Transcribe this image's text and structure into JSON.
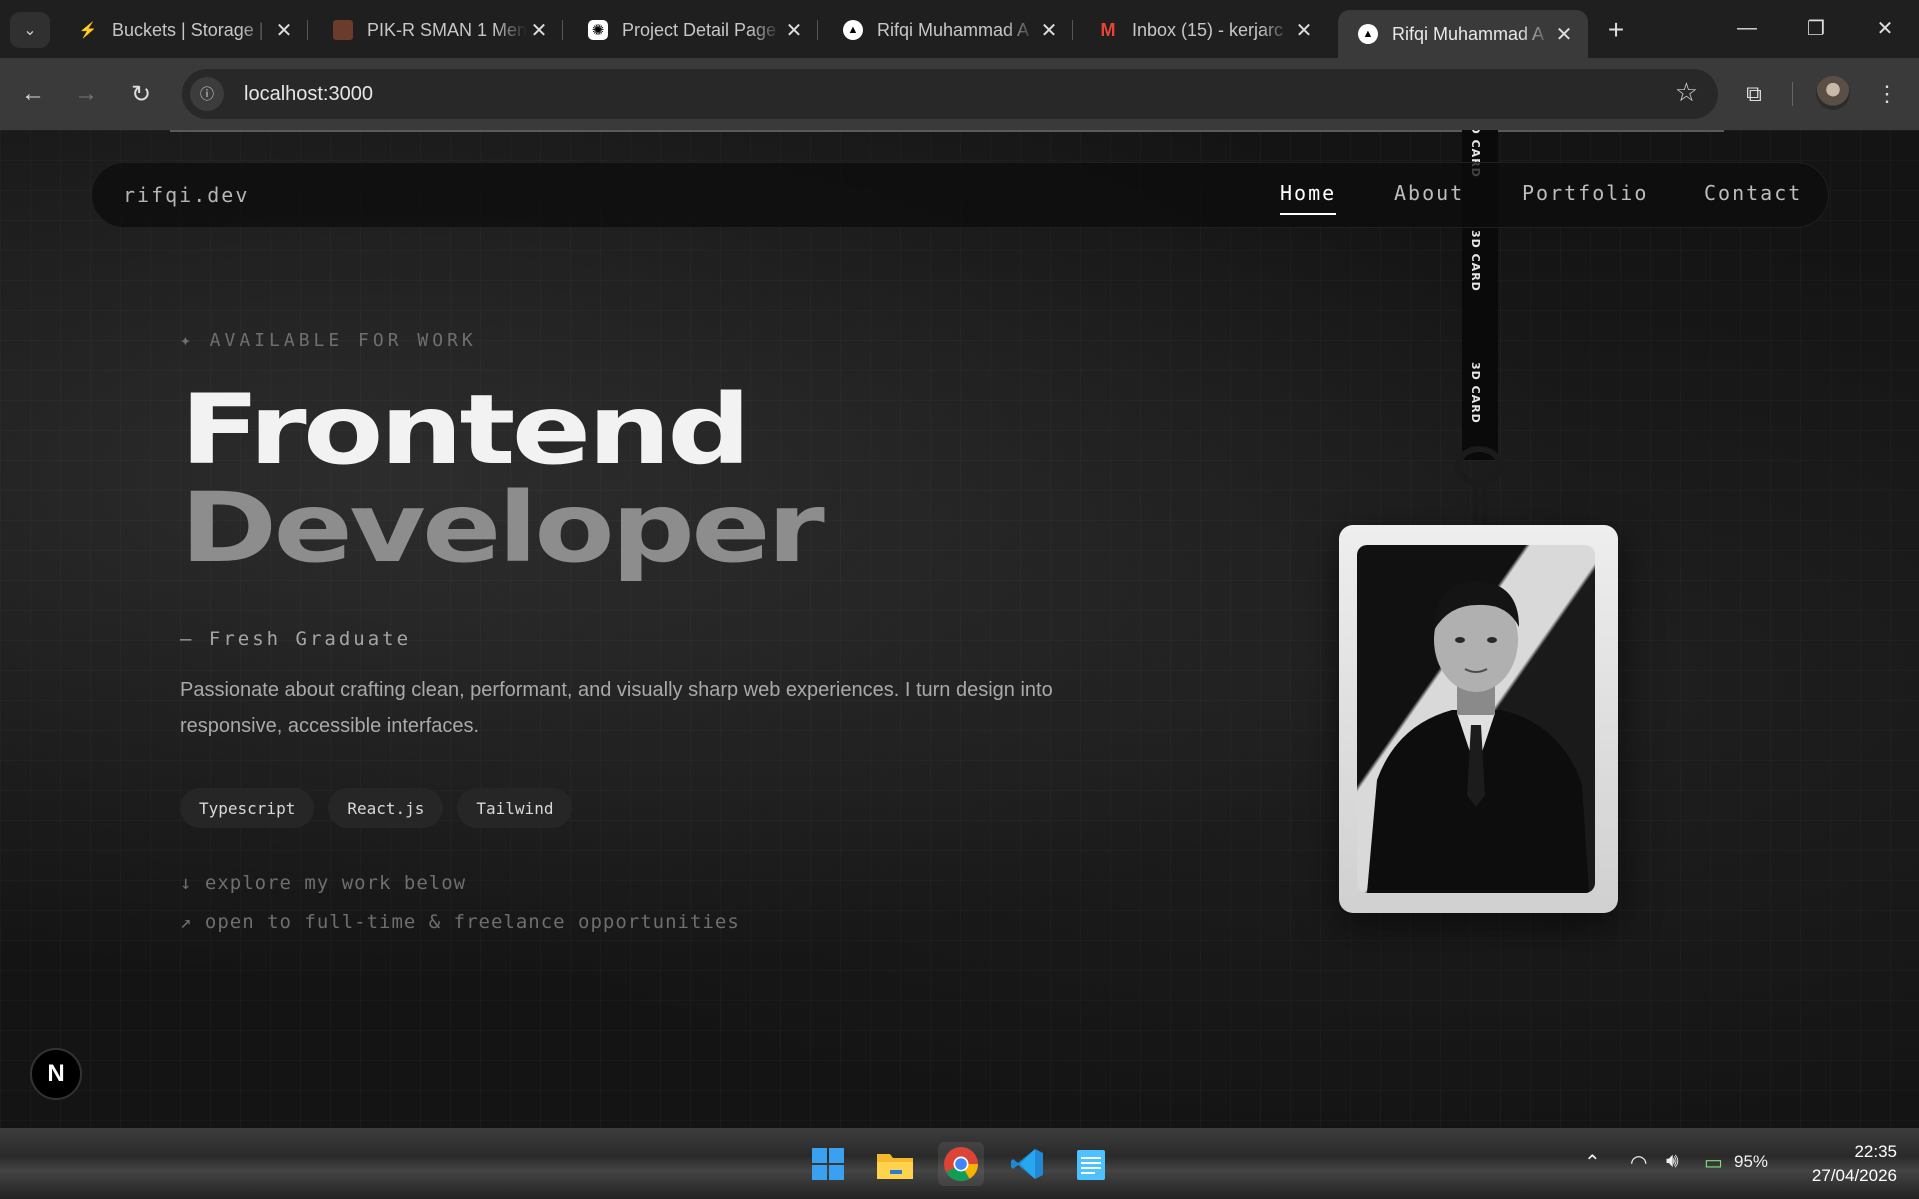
{
  "browser": {
    "tabs": [
      {
        "title": "Buckets | Storage |",
        "favicon": "supabase-icon",
        "active": false
      },
      {
        "title": "PIK-R SMAN 1 Men",
        "favicon": "image-favicon",
        "active": false
      },
      {
        "title": "Project Detail Page",
        "favicon": "openai-icon",
        "active": false
      },
      {
        "title": "Rifqi Muhammad A",
        "favicon": "vercel-triangle-icon",
        "active": false
      },
      {
        "title": "Inbox (15) - kerjarc",
        "favicon": "gmail-icon",
        "active": false
      },
      {
        "title": "Rifqi Muhammad A",
        "favicon": "vercel-triangle-icon",
        "active": true
      }
    ],
    "address": "localhost:3000"
  },
  "site": {
    "brand": "rifqi.dev",
    "nav": [
      "Home",
      "About",
      "Portfolio",
      "Contact"
    ],
    "active_nav": "Home",
    "eyebrow": "✦ AVAILABLE FOR WORK",
    "headline_line1": "Frontend",
    "headline_line2": "Developer",
    "subtitle": "— Fresh Graduate",
    "description": "Passionate about crafting clean, performant, and visually sharp web experiences. I turn design into responsive, accessible interfaces.",
    "skills": [
      "Typescript",
      "React.js",
      "Tailwind"
    ],
    "hint1": "↓ explore my work below",
    "hint2": "↗ open to full-time & freelance opportunities",
    "lanyard_text": "3D CARD",
    "next_badge": "N"
  },
  "taskbar": {
    "apps": [
      "windows-start-icon",
      "file-explorer-icon",
      "chrome-icon",
      "vscode-icon",
      "notepad-icon"
    ],
    "battery": "95%",
    "time": "22:35",
    "date": "27/04/2026"
  },
  "colors": {
    "page_bg": "#141414",
    "headline_primary": "#f2f2f2",
    "headline_secondary": "#8d8d8d",
    "chrome_bg": "#1f1f1f"
  }
}
